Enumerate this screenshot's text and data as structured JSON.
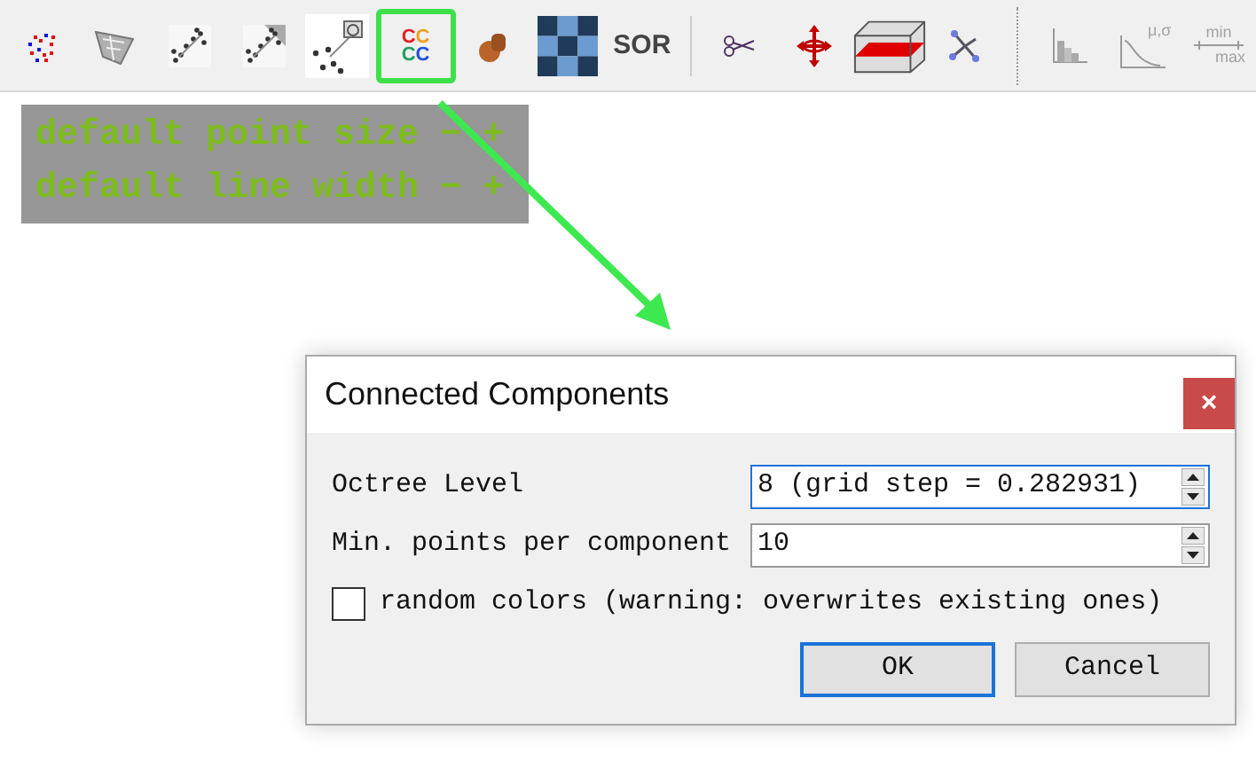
{
  "toolbar": {
    "groups": [
      {
        "items": [
          {
            "kind": "points",
            "highlighted": false,
            "disabled": false
          },
          {
            "kind": "mesh",
            "highlighted": false,
            "disabled": false
          },
          {
            "kind": "sample",
            "highlighted": false,
            "disabled": false
          },
          {
            "kind": "subsample",
            "highlighted": false,
            "disabled": false
          },
          {
            "kind": "cloud-link",
            "highlighted": false,
            "disabled": false
          },
          {
            "kind": "cc",
            "highlighted": true,
            "disabled": false,
            "labels": [
              "C",
              "C",
              "C",
              "C"
            ]
          },
          {
            "kind": "blob",
            "highlighted": false,
            "disabled": false
          },
          {
            "kind": "checker",
            "highlighted": false,
            "disabled": false
          },
          {
            "kind": "sor",
            "highlighted": false,
            "disabled": false,
            "labels": [
              "SOR"
            ]
          }
        ]
      },
      {
        "items": [
          {
            "kind": "scissors",
            "highlighted": false,
            "disabled": false
          },
          {
            "kind": "move",
            "highlighted": false,
            "disabled": false
          },
          {
            "kind": "box",
            "highlighted": false,
            "disabled": false
          },
          {
            "kind": "tree",
            "highlighted": false,
            "disabled": false
          }
        ]
      },
      {
        "items": [
          {
            "kind": "histogram",
            "highlighted": false,
            "disabled": true
          },
          {
            "kind": "gauss",
            "highlighted": false,
            "disabled": true,
            "labels": [
              "μ,σ"
            ]
          },
          {
            "kind": "minmax",
            "highlighted": false,
            "disabled": true,
            "labels": [
              "min",
              "max"
            ]
          }
        ]
      }
    ]
  },
  "overlay": {
    "rows": [
      {
        "label": "default point size",
        "minus": "−",
        "plus": "+"
      },
      {
        "label": "default line width",
        "minus": "−",
        "plus": "+"
      }
    ]
  },
  "dialog": {
    "title": "Connected Components",
    "close": "×",
    "fields": [
      {
        "label": "Octree Level",
        "value": "8 (grid step = 0.282931)",
        "focused": true
      },
      {
        "label": "Min. points per component",
        "value": "10",
        "focused": false
      }
    ],
    "checkbox": {
      "label": "random colors (warning: overwrites existing ones)",
      "checked": false
    },
    "buttons": [
      {
        "label": "OK",
        "default": true
      },
      {
        "label": "Cancel",
        "default": false
      }
    ]
  }
}
